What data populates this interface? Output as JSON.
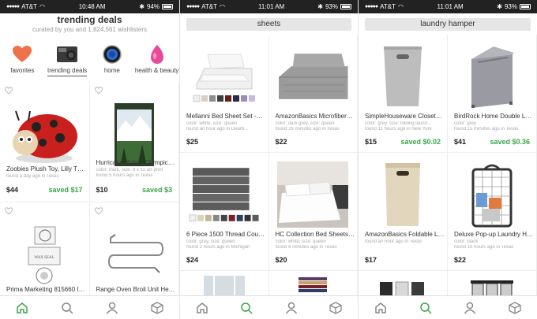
{
  "colors": {
    "accent_green": "#3aa64a",
    "status_bar": "#222222"
  },
  "screen1": {
    "status": {
      "carrier": "AT&T",
      "time": "10:48 AM",
      "battery": "94%"
    },
    "title": "trending deals",
    "subtitle": "curated by you and 1,824,561 wishlisters",
    "categories": [
      {
        "label": "favorites",
        "icon": "heart-icon"
      },
      {
        "label": "trending deals",
        "icon": "gopro-icon"
      },
      {
        "label": "home",
        "icon": "nest-thermostat-icon"
      },
      {
        "label": "health & beauty",
        "icon": "makeup-sponge-icon"
      }
    ],
    "products": [
      {
        "title": "Zoobies Plush Toy, Lilly T…",
        "meta1": "found a day ago in Texas",
        "meta2": "",
        "price": "$44",
        "saved": "saved $17"
      },
      {
        "title": "Hurricane Ridge, Olympic…",
        "meta1": "color: multi, size: 9 x 12 art print",
        "meta2": "found 5 hours ago in Texas",
        "price": "$10",
        "saved": "saved $3"
      },
      {
        "title": "Prima Marketing 815660 I…",
        "meta1": "",
        "meta2": "",
        "price": "",
        "saved": ""
      },
      {
        "title": "Range Oven Broil Unit He…",
        "meta1": "",
        "meta2": "",
        "price": "",
        "saved": ""
      }
    ]
  },
  "screen2": {
    "status": {
      "carrier": "AT&T",
      "time": "11:01 AM",
      "battery": "93%"
    },
    "search": "sheets",
    "products": [
      {
        "title": "Mellanni Bed Sheet Set -…",
        "meta1": "color: white, size: queen",
        "meta2": "found an hour ago in Dearb…",
        "price": "$25",
        "saved": ""
      },
      {
        "title": "AmazonBasics Microfiber…",
        "meta1": "color: dark grey, size: queen",
        "meta2": "found 26 minutes ago in Texas",
        "price": "$22",
        "saved": ""
      },
      {
        "title": "6 Piece 1500 Thread Cou…",
        "meta1": "color: gray, size: queen",
        "meta2": "found 2 hours ago in Michigan",
        "price": "$24",
        "saved": ""
      },
      {
        "title": "HC Collection Bed Sheets…",
        "meta1": "color: white, size: queen",
        "meta2": "found 8 minutes ago in Texas",
        "price": "$20",
        "saved": ""
      }
    ]
  },
  "screen3": {
    "status": {
      "carrier": "AT&T",
      "time": "11:01 AM",
      "battery": "93%"
    },
    "search": "laundry hamper",
    "products": [
      {
        "title": "SimpleHouseware Closet…",
        "meta1": "color: grey, size: folding laund…",
        "meta2": "found 11 hours ago in New York",
        "price": "$15",
        "saved": "saved $0.02"
      },
      {
        "title": "BirdRock Home Double L…",
        "meta1": "color: grey",
        "meta2": "found 15 minutes ago in Texas",
        "price": "$41",
        "saved": "saved $0.36"
      },
      {
        "title": "AmazonBasics Foldable L…",
        "meta1": "found an hour ago in Texas",
        "meta2": "",
        "price": "$17",
        "saved": ""
      },
      {
        "title": "Deluxe Pop-up Laundry H…",
        "meta1": "color: black",
        "meta2": "found 16 hours ago in Texas",
        "price": "$22",
        "saved": ""
      }
    ]
  },
  "tabs": [
    {
      "name": "home",
      "icon": "house-icon"
    },
    {
      "name": "search",
      "icon": "search-icon"
    },
    {
      "name": "profile",
      "icon": "person-icon"
    },
    {
      "name": "packages",
      "icon": "box-icon"
    }
  ]
}
